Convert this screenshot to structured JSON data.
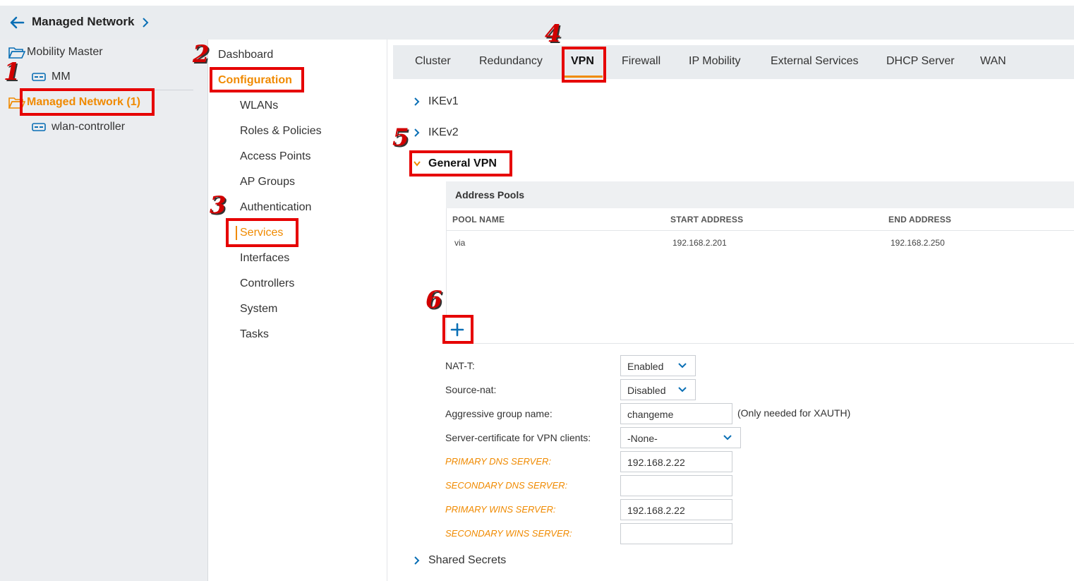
{
  "header": {
    "title": "Managed Network"
  },
  "tree": {
    "mobility_master": "Mobility Master",
    "mm": "MM",
    "managed_network": "Managed Network (1)",
    "wlan_controller": "wlan-controller"
  },
  "nav": {
    "dashboard": "Dashboard",
    "configuration": "Configuration",
    "items": [
      "WLANs",
      "Roles & Policies",
      "Access Points",
      "AP Groups",
      "Authentication",
      "Services",
      "Interfaces",
      "Controllers",
      "System",
      "Tasks"
    ]
  },
  "tabs": [
    "Cluster",
    "Redundancy",
    "VPN",
    "Firewall",
    "IP Mobility",
    "External Services",
    "DHCP Server",
    "WAN"
  ],
  "sections": {
    "ikev1": "IKEv1",
    "ikev2": "IKEv2",
    "general_vpn": "General VPN",
    "shared_secrets": "Shared Secrets"
  },
  "address_pools": {
    "title": "Address Pools",
    "columns": [
      "POOL NAME",
      "START ADDRESS",
      "END ADDRESS"
    ],
    "rows": [
      {
        "pool_name": "via",
        "start_address": "192.168.2.201",
        "end_address": "192.168.2.250"
      }
    ]
  },
  "form": {
    "nat_t": {
      "label": "NAT-T:",
      "value": "Enabled"
    },
    "source_nat": {
      "label": "Source-nat:",
      "value": "Disabled"
    },
    "aggressive_group": {
      "label": "Aggressive group name:",
      "value": "changeme",
      "note": "(Only needed for XAUTH)"
    },
    "server_cert": {
      "label": "Server-certificate for VPN clients:",
      "value": "-None-"
    },
    "primary_dns": {
      "label": "PRIMARY DNS SERVER:",
      "value": "192.168.2.22"
    },
    "secondary_dns": {
      "label": "SECONDARY DNS SERVER:",
      "value": ""
    },
    "primary_wins": {
      "label": "PRIMARY WINS SERVER:",
      "value": "192.168.2.22"
    },
    "secondary_wins": {
      "label": "SECONDARY WINS SERVER:",
      "value": ""
    }
  },
  "annotations": [
    "1",
    "2",
    "3",
    "4",
    "5",
    "6"
  ],
  "colors": {
    "accent": "#f08a00",
    "link_blue": "#0a6fb5",
    "annotation_red": "#e60000"
  }
}
